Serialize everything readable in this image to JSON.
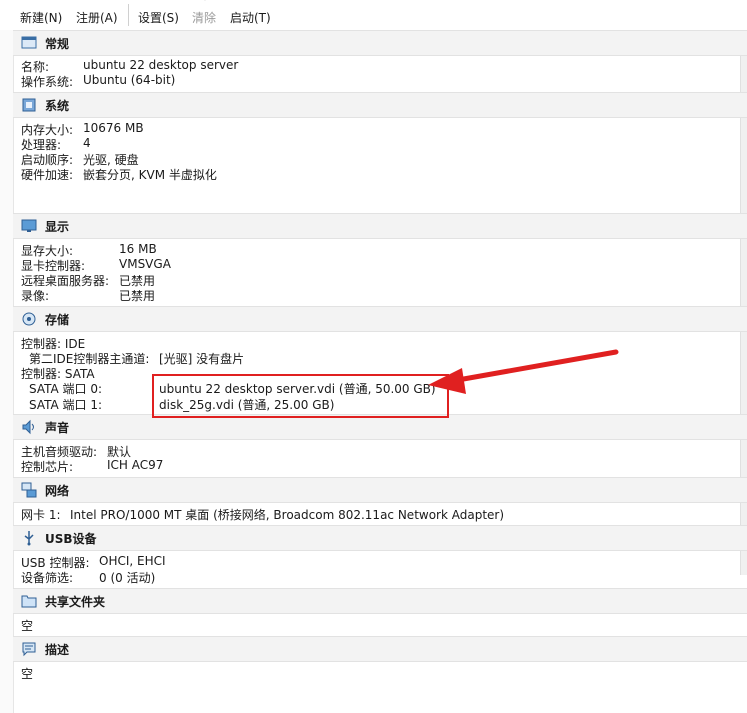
{
  "toolbar": {
    "new_label": "新建(N)",
    "register_label": "注册(A)",
    "settings_label": "设置(S)",
    "discard_label": "清除",
    "start_label": "启动(T)"
  },
  "general": {
    "title": "常规",
    "name_label": "名称:",
    "name_value": "ubuntu 22 desktop server",
    "os_label": "操作系统:",
    "os_value": "Ubuntu (64-bit)"
  },
  "system": {
    "title": "系统",
    "memory_label": "内存大小:",
    "memory_value": "10676 MB",
    "cpu_label": "处理器:",
    "cpu_value": "4",
    "boot_label": "启动顺序:",
    "boot_value": "光驱, 硬盘",
    "accel_label": "硬件加速:",
    "accel_value": "嵌套分页, KVM 半虚拟化"
  },
  "display": {
    "title": "显示",
    "vram_label": "显存大小:",
    "vram_value": "16 MB",
    "controller_label": "显卡控制器:",
    "controller_value": "VMSVGA",
    "rdp_label": "远程桌面服务器:",
    "rdp_value": "已禁用",
    "recording_label": "录像:",
    "recording_value": "已禁用"
  },
  "storage": {
    "title": "存储",
    "ide_controller": "控制器: IDE",
    "ide_secondary_label": "第二IDE控制器主通道:",
    "ide_secondary_value": "[光驱] 没有盘片",
    "sata_controller": "控制器: SATA",
    "sata0_label": "SATA 端口 0:",
    "sata0_value": "ubuntu 22 desktop server.vdi (普通, 50.00 GB)",
    "sata1_label": "SATA 端口 1:",
    "sata1_value": "disk_25g.vdi (普通, 25.00 GB)"
  },
  "audio": {
    "title": "声音",
    "driver_label": "主机音频驱动:",
    "driver_value": "默认",
    "chip_label": "控制芯片:",
    "chip_value": "ICH AC97"
  },
  "network": {
    "title": "网络",
    "nic1_label": "网卡 1:",
    "nic1_value": "Intel PRO/1000 MT 桌面 (桥接网络, Broadcom 802.11ac Network Adapter)"
  },
  "usb": {
    "title": "USB设备",
    "controller_label": "USB 控制器:",
    "controller_value": "OHCI, EHCI",
    "filter_label": "设备筛选:",
    "filter_value": "0 (0 活动)"
  },
  "shared": {
    "title": "共享文件夹",
    "value": "空"
  },
  "description": {
    "title": "描述",
    "value": "空"
  },
  "colors": {
    "annotation": "#e02020",
    "section_bg": "#f3f3f3"
  }
}
